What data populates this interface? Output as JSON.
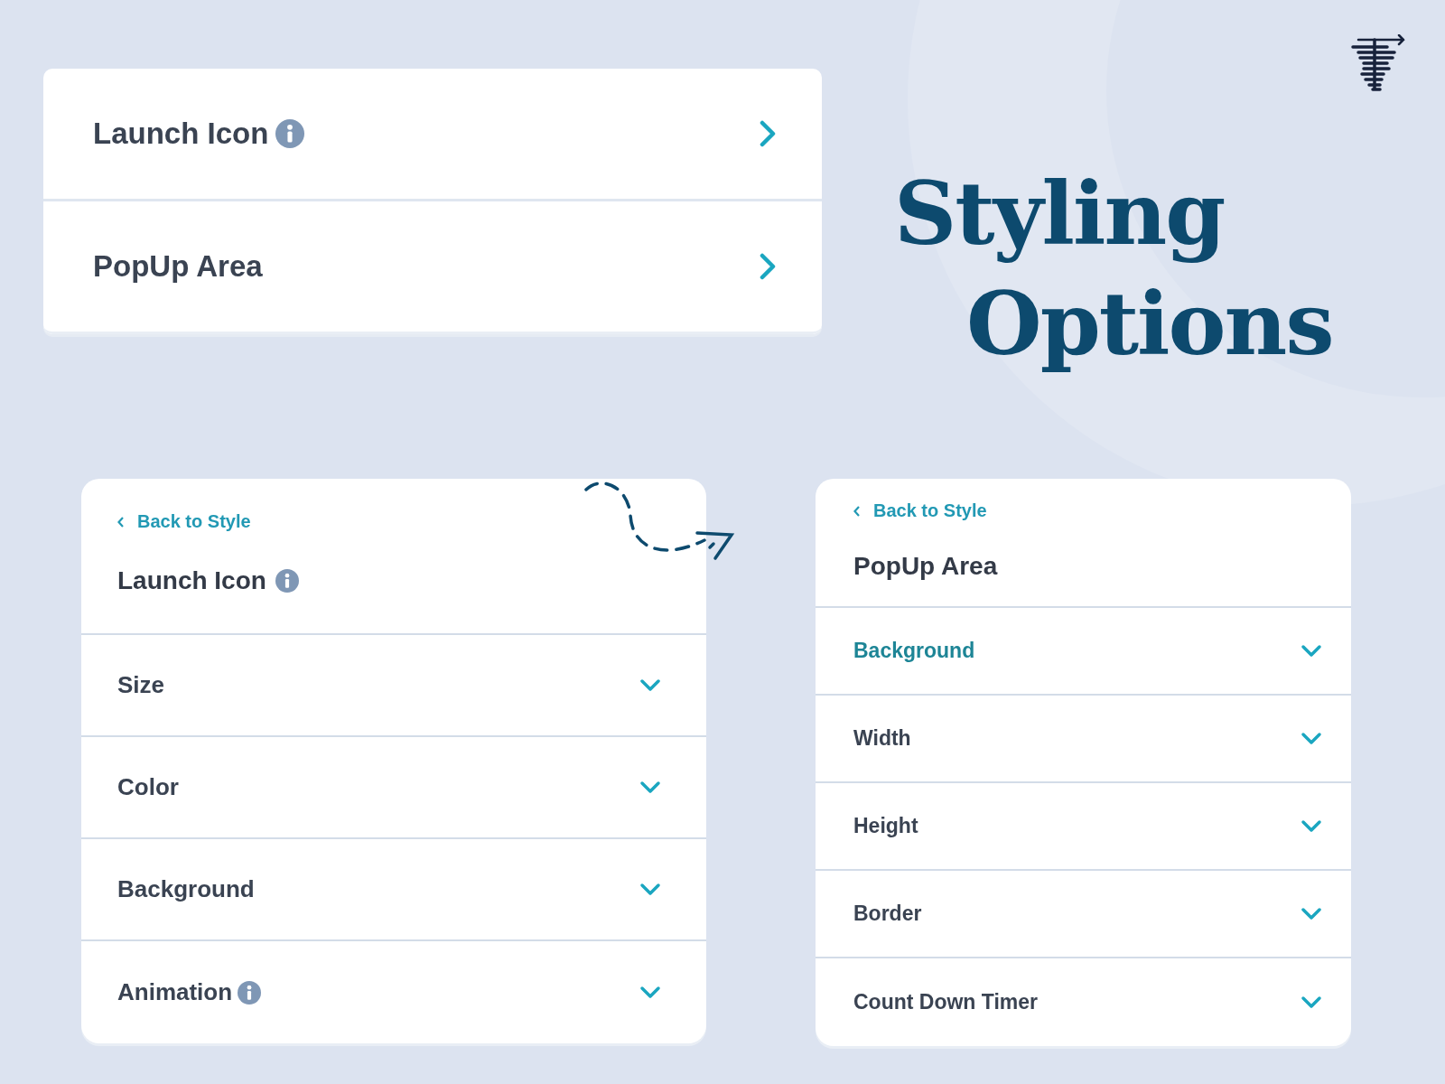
{
  "menu_card": {
    "items": [
      {
        "label": "Launch Icon",
        "info": true
      },
      {
        "label": "PopUp Area",
        "info": false
      }
    ]
  },
  "title_lines": [
    "Styling",
    "Options"
  ],
  "panels": [
    {
      "back_link": "Back to Style",
      "title": "Launch Icon",
      "info": true,
      "sections": [
        {
          "label": "Size",
          "info": false,
          "selected": false
        },
        {
          "label": "Color",
          "info": false,
          "selected": false
        },
        {
          "label": "Background",
          "info": false,
          "selected": false
        },
        {
          "label": "Animation",
          "info": true,
          "selected": false
        }
      ]
    },
    {
      "back_link": "Back to Style",
      "title": "PopUp Area",
      "info": false,
      "sections": [
        {
          "label": "Background",
          "info": false,
          "selected": true
        },
        {
          "label": "Width",
          "info": false,
          "selected": false
        },
        {
          "label": "Height",
          "info": false,
          "selected": false
        },
        {
          "label": "Border",
          "info": false,
          "selected": false
        },
        {
          "label": "Count Down Timer",
          "info": false,
          "selected": false
        }
      ]
    }
  ]
}
